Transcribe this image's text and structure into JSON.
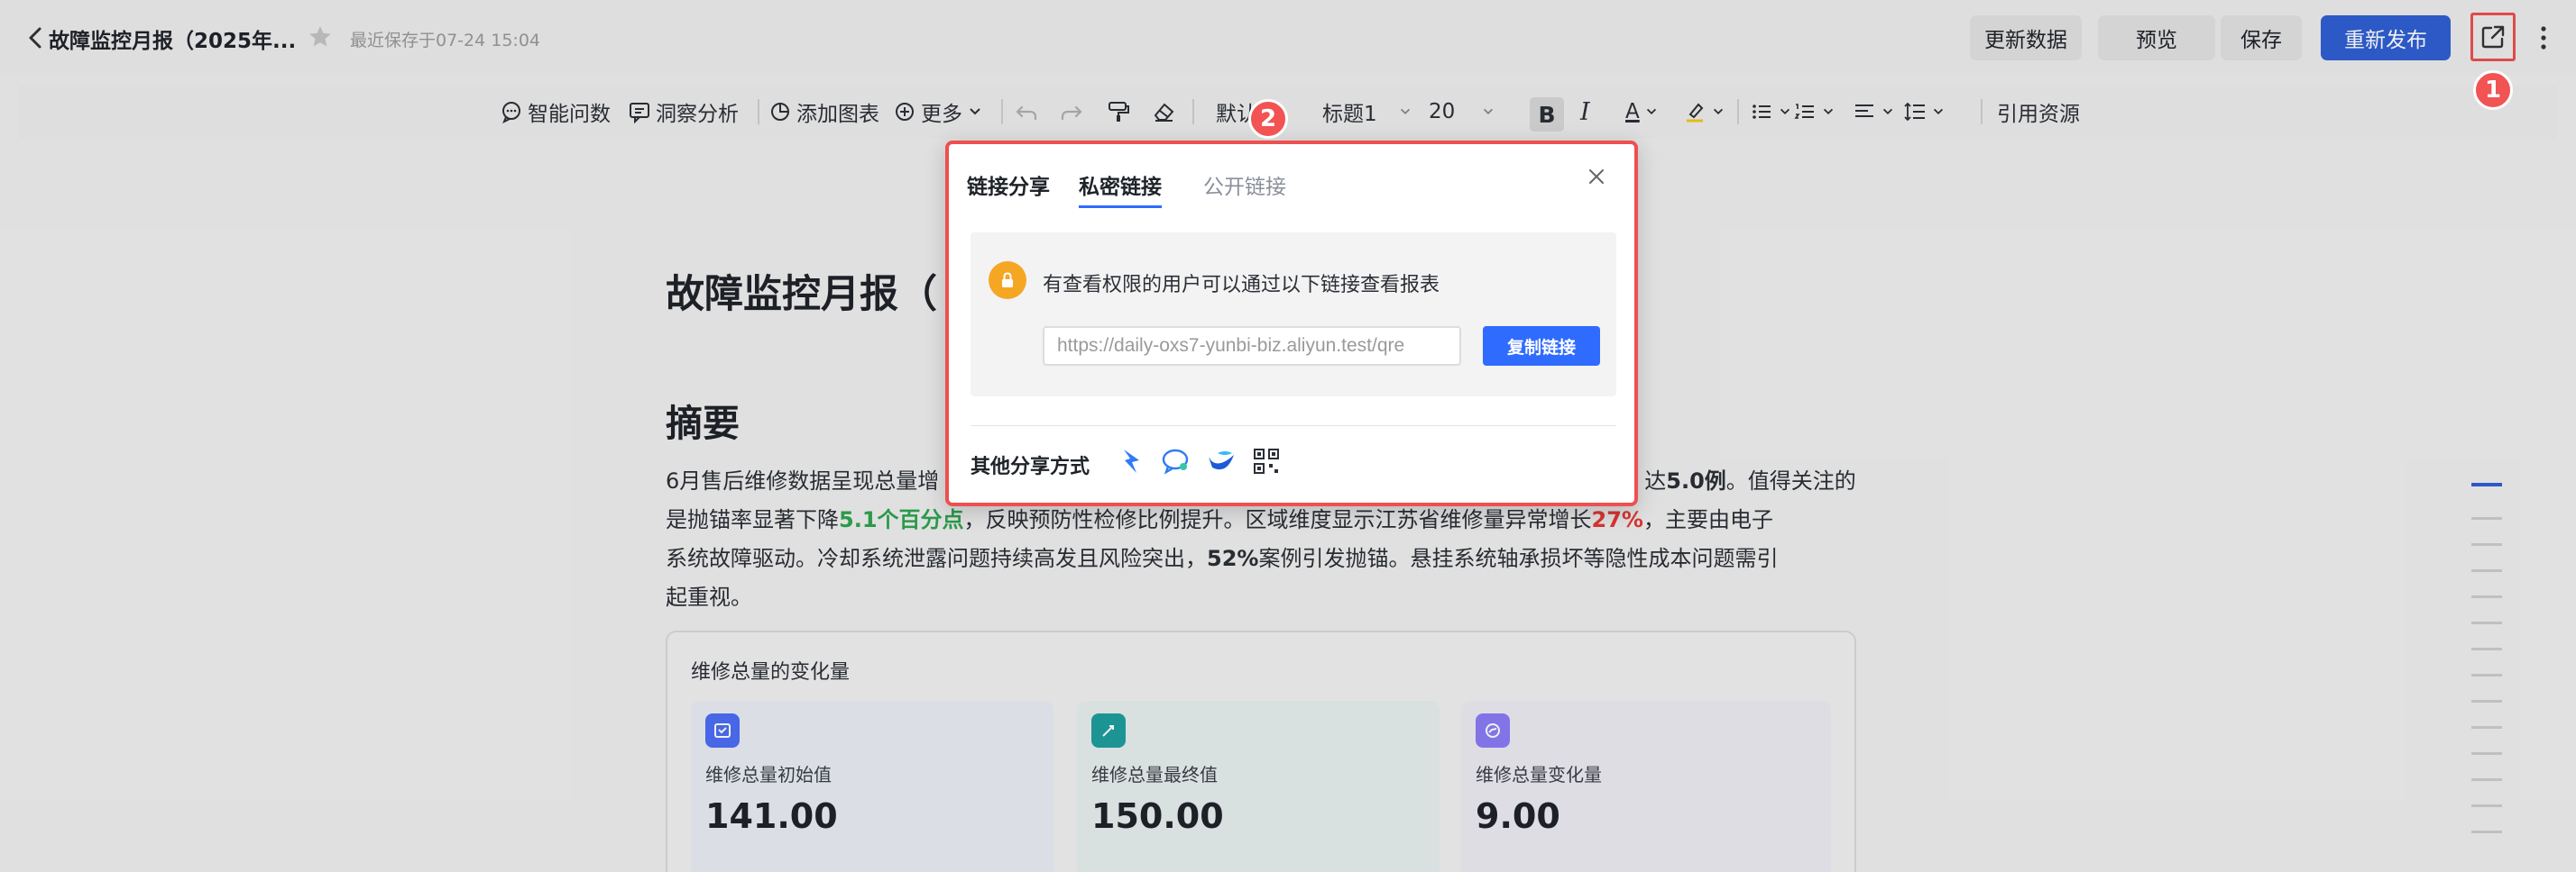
{
  "header": {
    "title": "故障监控月报（2025年...",
    "save_status": "最近保存于07-24 15:04",
    "buttons": {
      "refresh": "更新数据",
      "preview": "预览",
      "save": "保存",
      "republish": "重新发布"
    },
    "badge_1": "1",
    "badge_2": "2"
  },
  "toolbar": {
    "smart_qa": "智能问数",
    "insight": "洞察分析",
    "add_chart": "添加图表",
    "more": "更多",
    "font_family": "默认",
    "heading": "标题1",
    "font_size": "20",
    "bold": "B",
    "italic": "I",
    "font_color": "A",
    "cite": "引用资源"
  },
  "document": {
    "title": "故障监控月报（",
    "summary_heading": "摘要",
    "para": {
      "l1_a": "6月售后维修数据呈现总量增",
      "l1_b": "达",
      "l1_bold": "5.0例",
      "l1_c": "。值得关注的",
      "l2_a": "是抛锚率显著下降",
      "l2_green": "5.1个百分点",
      "l2_b": "，反映预防性检修比例提升。区域维度显示江苏省维修量异常增长",
      "l2_red": "27%",
      "l2_c": "，主要由电子",
      "l3_a": "系统故障驱动。冷却系统泄露问题持续高发且风险突出，",
      "l3_bold": "52%",
      "l3_b": "案例引发抛锚。悬挂系统轴承损坏等隐性成本问题需引",
      "l4": "起重视。"
    },
    "card": {
      "title": "维修总量的变化量",
      "metrics": [
        {
          "label": "维修总量初始值",
          "value": "141.00"
        },
        {
          "label": "维修总量最终值",
          "value": "150.00"
        },
        {
          "label": "维修总量变化量",
          "value": "9.00"
        }
      ]
    }
  },
  "modal": {
    "tab_title": "链接分享",
    "tab_private": "私密链接",
    "tab_public": "公开链接",
    "info": "有查看权限的用户可以通过以下链接查看报表",
    "url": "https://daily-oxs7-yunbi-biz.aliyun.test/qre",
    "copy_button": "复制链接",
    "other_share": "其他分享方式",
    "share_icons": [
      "dingtalk-icon",
      "chat-icon",
      "teambition-icon",
      "qr-code-icon"
    ]
  },
  "colors": {
    "primary": "#2f5fd3",
    "highlight_red": "#ef4f4f",
    "positive_green": "#2ea44f",
    "negative_red": "#e53935",
    "lock_orange": "#f5a623"
  }
}
